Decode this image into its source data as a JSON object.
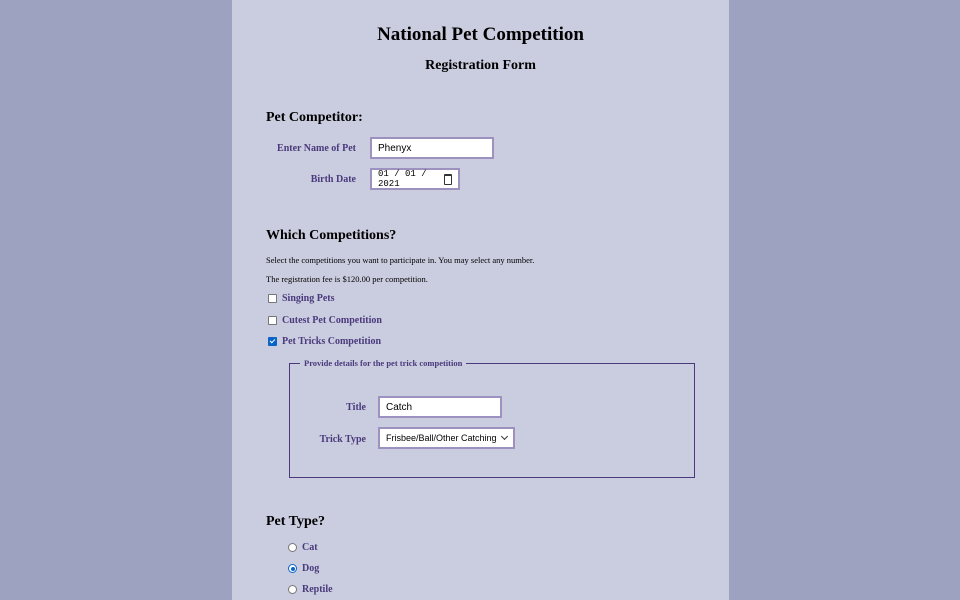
{
  "header": {
    "title": "National Pet Competition",
    "subtitle": "Registration Form"
  },
  "pet_competitor": {
    "heading": "Pet Competitor:",
    "name_label": "Enter Name of Pet",
    "name_value": "Phenyx",
    "birth_label": "Birth Date",
    "birth_value": "01 / 01 / 2021"
  },
  "competitions": {
    "heading": "Which Competitions?",
    "help_1": "Select the competitions you want to participate in. You may select any number.",
    "help_2": "The registration fee is $120.00 per competition.",
    "options": [
      {
        "label": "Singing Pets",
        "checked": false
      },
      {
        "label": "Cutest Pet Competition",
        "checked": false
      },
      {
        "label": "Pet Tricks Competition",
        "checked": true
      }
    ],
    "details": {
      "legend": "Provide details for the pet trick competition",
      "title_label": "Title",
      "title_value": "Catch",
      "trick_type_label": "Trick Type",
      "trick_type_value": "Frisbee/Ball/Other Catching"
    }
  },
  "pet_type": {
    "heading": "Pet Type?",
    "options": [
      {
        "label": "Cat",
        "checked": false
      },
      {
        "label": "Dog",
        "checked": true
      },
      {
        "label": "Reptile",
        "checked": false
      }
    ]
  },
  "colors": {
    "outer_background": "#9da2c1",
    "page_background": "#caccdf",
    "label_color": "#4a3a7c",
    "accent": "#0a64c8"
  }
}
